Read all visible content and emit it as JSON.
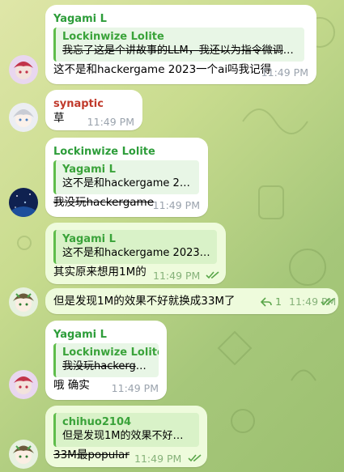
{
  "colors": {
    "name_green": "#2d9d3a",
    "name_red": "#c0392b",
    "reply_accent": "#5fbd4b",
    "time_gray": "#9aa3ad",
    "out_bubble": "#eefbdc",
    "in_bubble": "#ffffff"
  },
  "messages": [
    {
      "sender": "Yagami L",
      "reply_name": "Lockinwize Lolite",
      "reply_text": "我忘了这是个讲故事的LLM，我还以为指令微调过…",
      "text": "这不是和hackergame 2023一个ai吗我记得",
      "time": "11:49 PM"
    },
    {
      "sender": "synaptic",
      "text": "草",
      "time": "11:49 PM"
    },
    {
      "sender": "Lockinwize Lolite",
      "reply_name": "Yagami L",
      "reply_text": "这不是和hackergame 202…",
      "text": "我没玩hackergame",
      "time": "11:49 PM"
    },
    {
      "reply_name": "Yagami L",
      "reply_text": "这不是和hackergame 2023一…",
      "text": "其实原来想用1M的",
      "time": "11:49 PM"
    },
    {
      "text": "但是发现1M的效果不好就换成33M了",
      "reply_count": "1",
      "time": "11:49 PM"
    },
    {
      "sender": "Yagami L",
      "reply_name": "Lockinwize Lolite",
      "reply_text": "我没玩hackergame",
      "text": "哦 确实",
      "time": "11:49 PM"
    },
    {
      "reply_name": "chihuo2104",
      "reply_text": "但是发现1M的效果不好就…",
      "text": "33M最popular",
      "time": "11:49 PM"
    }
  ]
}
